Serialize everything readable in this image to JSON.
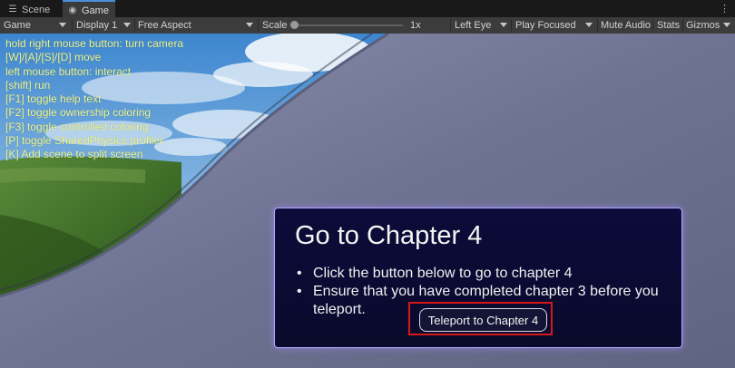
{
  "tabs": [
    {
      "label": "Scene",
      "icon": "scene-icon"
    },
    {
      "label": "Game",
      "icon": "gamepad-icon",
      "active": true
    }
  ],
  "tab_menu_icon": "more-vertical-icon",
  "toolbar": {
    "game_dropdown": "Game",
    "display_dropdown": "Display 1",
    "aspect_dropdown": "Free Aspect",
    "scale_label": "Scale",
    "scale_value": "1x",
    "eye_dropdown": "Left Eye",
    "play_mode_dropdown": "Play Focused",
    "mute_audio": "Mute Audio",
    "stats": "Stats",
    "gizmos_dropdown": "Gizmos"
  },
  "debug_lines": [
    "hold right mouse button: turn camera",
    "[W]/[A]/[S]/[D] move",
    "left mouse button: interact",
    "[shift] run",
    "[F1] toggle help text",
    "[F2] toggle ownership coloring",
    "[F3] toggle controlled coloring",
    "[P] toggle SharedPhysics profiler",
    "[K] Add scene to split screen"
  ],
  "panel": {
    "title": "Go to Chapter 4",
    "bullets": [
      "Click the button below to go to chapter 4",
      "Ensure that you have completed chapter 3 before you teleport."
    ],
    "button_label": "Teleport to Chapter 4"
  },
  "colors": {
    "debug_text": "#eef58a",
    "panel_bg": "#0c0b3a",
    "panel_border": "#b7a6ff",
    "highlight_box": "#d81818",
    "active_tab_accent": "#4a90d9"
  }
}
